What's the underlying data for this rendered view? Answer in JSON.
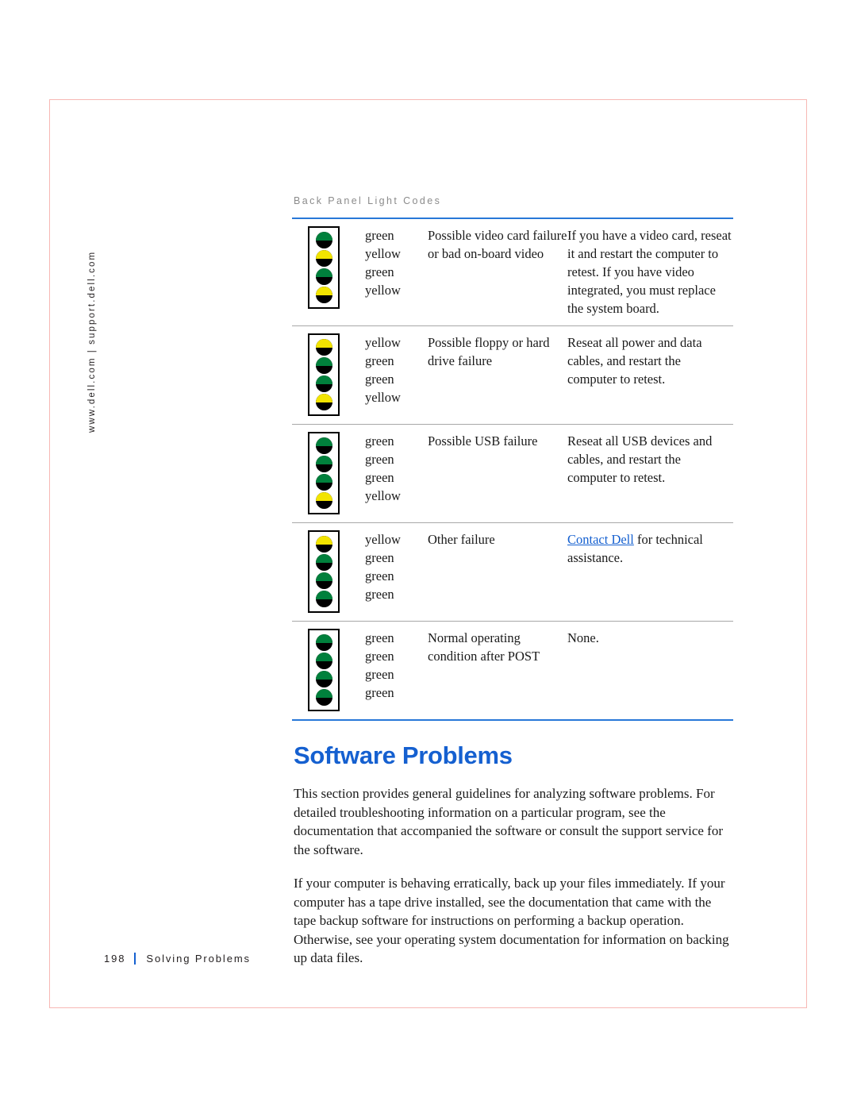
{
  "side_url": "www.dell.com | support.dell.com",
  "running_head": "Back Panel Light Codes",
  "table": {
    "rows": [
      {
        "leds": [
          "green",
          "yellow",
          "green",
          "yellow"
        ],
        "colors": [
          "green",
          "yellow",
          "green",
          "yellow"
        ],
        "description": "Possible video card failure or bad on-board video",
        "action": "If you have a video card, reseat it and restart the computer to retest. If you have video integrated, you must replace the system board."
      },
      {
        "leds": [
          "yellow",
          "green",
          "green",
          "yellow"
        ],
        "colors": [
          "yellow",
          "green",
          "green",
          "yellow"
        ],
        "description": "Possible floppy or hard drive failure",
        "action": "Reseat all power and data cables, and restart the computer to retest."
      },
      {
        "leds": [
          "green",
          "green",
          "green",
          "yellow"
        ],
        "colors": [
          "green",
          "green",
          "green",
          "yellow"
        ],
        "description": "Possible USB failure",
        "action": "Reseat all USB devices and cables, and restart the computer to retest."
      },
      {
        "leds": [
          "yellow",
          "green",
          "green",
          "green"
        ],
        "colors": [
          "yellow",
          "green",
          "green",
          "green"
        ],
        "description": "Other failure",
        "action_link": "Contact Dell",
        "action_rest": " for technical assistance."
      },
      {
        "leds": [
          "green",
          "green",
          "green",
          "green"
        ],
        "colors": [
          "green",
          "green",
          "green",
          "green"
        ],
        "description": "Normal operating condition after POST",
        "action": "None."
      }
    ]
  },
  "section": {
    "heading": "Software Problems",
    "paragraph_1": "This section provides general guidelines for analyzing software problems. For detailed troubleshooting information on a particular program, see the documentation that accompanied the software or consult the support service for the software.",
    "paragraph_2": "If your computer is behaving erratically, back up your files immediately. If your computer has a tape drive installed, see the documentation that came with the tape backup software for instructions on performing a backup operation. Otherwise, see your operating system documentation for information on backing up data files."
  },
  "footer": {
    "page_number": "198",
    "section_name": "Solving Problems"
  },
  "colors": {
    "link_blue": "#1560d0",
    "rule_blue": "#2878d8",
    "rule_gray": "#a8a8a8",
    "led_green": "#00803c",
    "led_yellow": "#f2e400",
    "page_border": "#f7b8b4",
    "running_head_gray": "#8b8b8b"
  }
}
